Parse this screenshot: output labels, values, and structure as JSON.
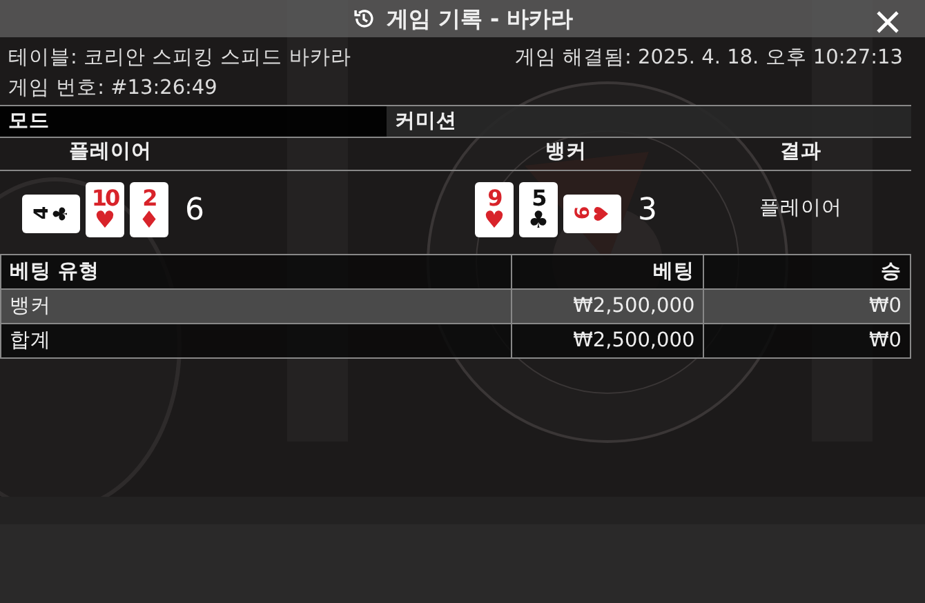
{
  "window": {
    "title": "게임 기록 - 바카라"
  },
  "info": {
    "table": "테이블: 코리안 스피킹 스피드 바카라",
    "resolved": "게임 해결됨: 2025. 4. 18. 오후 10:27:13",
    "game_number": "게임 번호: #13:26:49"
  },
  "mode_row": [
    {
      "label": "모드"
    },
    {
      "label": "커미션"
    }
  ],
  "hands": {
    "columns": [
      "플레이어",
      "뱅커",
      "결과"
    ],
    "player": {
      "cards": [
        {
          "rank": "4",
          "suit": "♣",
          "color": "#111111",
          "rotated": true
        },
        {
          "rank": "10",
          "suit": "♥",
          "color": "#d8232a",
          "rotated": false
        },
        {
          "rank": "2",
          "suit": "♦",
          "color": "#d8232a",
          "rotated": false
        }
      ],
      "score": "6"
    },
    "banker": {
      "cards": [
        {
          "rank": "9",
          "suit": "♥",
          "color": "#d8232a",
          "rotated": false
        },
        {
          "rank": "5",
          "suit": "♣",
          "color": "#111111",
          "rotated": false
        },
        {
          "rank": "6",
          "suit": "♥",
          "color": "#d8232a",
          "rotated": true
        }
      ],
      "score": "3"
    },
    "result": "플레이어"
  },
  "bets": {
    "columns": [
      "베팅 유형",
      "베팅",
      "승"
    ],
    "rows": [
      {
        "cells": [
          "뱅커",
          "₩2,500,000",
          "₩0"
        ],
        "highlighted": true
      },
      {
        "cells": [
          "합계",
          "₩2,500,000",
          "₩0"
        ],
        "highlighted": false
      }
    ]
  }
}
